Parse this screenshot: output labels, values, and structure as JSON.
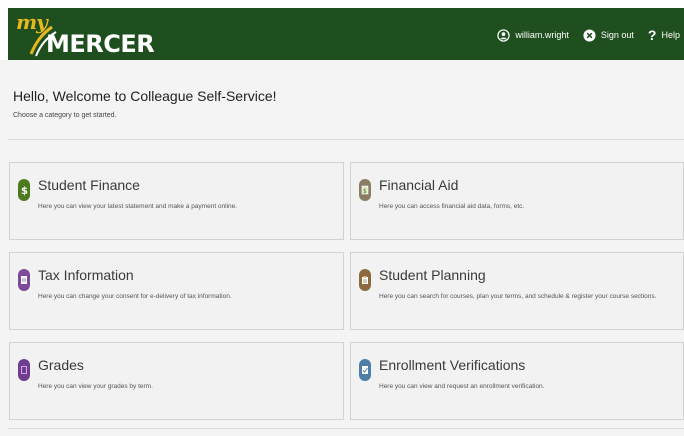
{
  "header": {
    "logo_prefix": "my",
    "logo_word": "MERCER",
    "user_label": "william.wright",
    "signout_label": "Sign out",
    "help_label": "Help",
    "help_symbol": "?",
    "bg_color": "#1f4f1f",
    "accent_color": "#e8b820"
  },
  "page": {
    "welcome": "Hello, Welcome to Colleague Self-Service!",
    "subtitle": "Choose a category to get started."
  },
  "cards": [
    {
      "title": "Student Finance",
      "description": "Here you can view your latest statement and make a payment online.",
      "icon": "dollar-coin-icon",
      "icon_color": "#4e7a1e"
    },
    {
      "title": "Financial Aid",
      "description": "Here you can access financial aid data, forms, etc.",
      "icon": "financial-aid-icon",
      "icon_color": "#8a7d63"
    },
    {
      "title": "Tax Information",
      "description": "Here you can change your consent for e-delivery of tax information.",
      "icon": "tax-document-icon",
      "icon_color": "#7d4a9b"
    },
    {
      "title": "Student Planning",
      "description": "Here you can search for courses, plan your terms, and schedule & register your course sections.",
      "icon": "planning-clipboard-icon",
      "icon_color": "#8a6a3e"
    },
    {
      "title": "Grades",
      "description": "Here you can view your grades by term.",
      "icon": "grades-book-icon",
      "icon_color": "#6e3d8f"
    },
    {
      "title": "Enrollment Verifications",
      "description": "Here you can view and request an enrollment verification.",
      "icon": "enrollment-verification-icon",
      "icon_color": "#4d7fa8"
    }
  ]
}
